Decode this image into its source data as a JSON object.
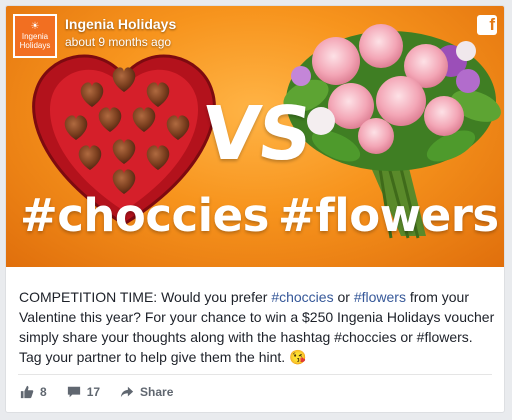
{
  "page": {
    "name": "Ingenia Holidays",
    "time": "about 9 months ago",
    "logo_line1": "Ingenia",
    "logo_line2": "Holidays"
  },
  "image": {
    "vs": "VS",
    "hashtag_left": "#choccies",
    "hashtag_right": "#flowers"
  },
  "post": {
    "t1": "COMPETITION TIME: Would you prefer ",
    "tag1": "#choccies",
    "t2": " or ",
    "tag2": "#flowers",
    "t3": " from your Valentine this year? For your chance to win a $250 Ingenia Holidays voucher simply share your thoughts along with the hashtag #choccies or #flowers. Tag your partner to help give them the hint. ",
    "emoji": "😘"
  },
  "actions": {
    "likes": "8",
    "comments": "17",
    "share": "Share"
  },
  "colors": {
    "brand": "#f26f21",
    "link": "#365899",
    "hero": "#f7941d"
  }
}
